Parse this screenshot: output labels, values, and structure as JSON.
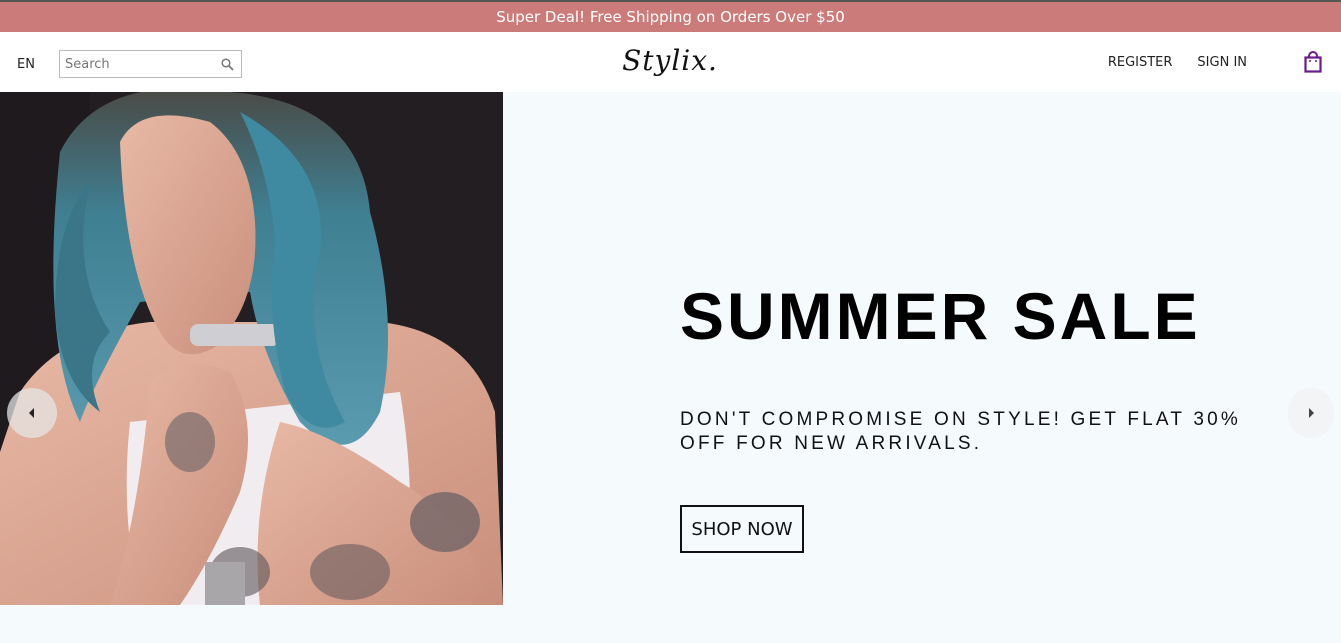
{
  "announcement": {
    "text": "Super Deal! Free Shipping on Orders Over $50"
  },
  "header": {
    "language": "EN",
    "search": {
      "placeholder": "Search",
      "value": ""
    },
    "logo": "Stylix.",
    "register_label": "REGISTER",
    "signin_label": "SIGN IN",
    "cart_icon": "shopping-bag-icon"
  },
  "hero": {
    "title": "SUMMER SALE",
    "subtitle": "DON'T COMPROMISE ON STYLE! GET FLAT 30% OFF FOR NEW ARRIVALS.",
    "button_label": "SHOP NOW",
    "left_arrow_icon": "arrow-left-icon",
    "right_arrow_icon": "arrow-right-icon"
  },
  "colors": {
    "announcement_bg": "#cc7b7b",
    "hero_bg": "#f5fafd",
    "cart_icon": "#6a1b8a"
  }
}
